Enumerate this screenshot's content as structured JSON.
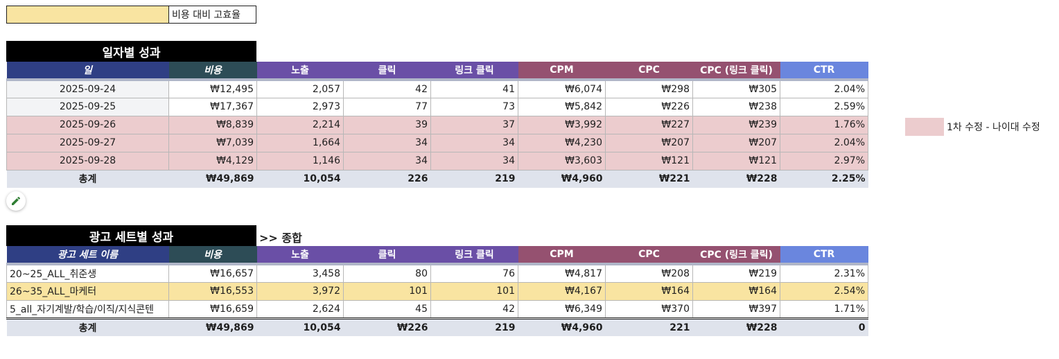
{
  "legend_top": {
    "label": "비용 대비 고효율",
    "color": "#f9e4a1"
  },
  "legend_side": {
    "label": "1차 수정 - 나이대 수정",
    "color": "#ecccce"
  },
  "colors": {
    "day_header": "#2f3f84",
    "cost_header": "#2d4c56",
    "purple_header": "#6a4fa6",
    "wine_header": "#955170",
    "ctr_header": "#6a86de",
    "highlight_pink": "#ecccce",
    "highlight_yellow": "#f9e4a1"
  },
  "daily": {
    "title": "일자별 성과",
    "headers": [
      "일",
      "비용",
      "노출",
      "클릭",
      "링크 클릭",
      "CPM",
      "CPC",
      "CPC (링크 클릭)",
      "CTR"
    ],
    "rows": [
      {
        "cells": [
          "2025-09-24",
          "₩12,495",
          "2,057",
          "42",
          "41",
          "₩6,074",
          "₩298",
          "₩305",
          "2.04%"
        ],
        "highlight": "none"
      },
      {
        "cells": [
          "2025-09-25",
          "₩17,367",
          "2,973",
          "77",
          "73",
          "₩5,842",
          "₩226",
          "₩238",
          "2.59%"
        ],
        "highlight": "none"
      },
      {
        "cells": [
          "2025-09-26",
          "₩8,839",
          "2,214",
          "39",
          "37",
          "₩3,992",
          "₩227",
          "₩239",
          "1.76%"
        ],
        "highlight": "pink"
      },
      {
        "cells": [
          "2025-09-27",
          "₩7,039",
          "1,664",
          "34",
          "34",
          "₩4,230",
          "₩207",
          "₩207",
          "2.04%"
        ],
        "highlight": "pink"
      },
      {
        "cells": [
          "2025-09-28",
          "₩4,129",
          "1,146",
          "34",
          "34",
          "₩3,603",
          "₩121",
          "₩121",
          "2.97%"
        ],
        "highlight": "pink"
      }
    ],
    "total": [
      "총계",
      "₩49,869",
      "10,054",
      "226",
      "219",
      "₩4,960",
      "₩221",
      "₩228",
      "2.25%"
    ]
  },
  "adset": {
    "title": "광고 세트별 성과",
    "aside": ">> 종합",
    "headers": [
      "광고 세트 이름",
      "비용",
      "노출",
      "클릭",
      "링크 클릭",
      "CPM",
      "CPC",
      "CPC (링크 클릭)",
      "CTR"
    ],
    "rows": [
      {
        "cells": [
          "20~25_ALL_취준생",
          "₩16,657",
          "3,458",
          "80",
          "76",
          "₩4,817",
          "₩208",
          "₩219",
          "2.31%"
        ],
        "highlight": "none"
      },
      {
        "cells": [
          "26~35_ALL_마케터",
          "₩16,553",
          "3,972",
          "101",
          "101",
          "₩4,167",
          "₩164",
          "₩164",
          "2.54%"
        ],
        "highlight": "yellow"
      },
      {
        "cells": [
          "5_all_자기계발/학습/이직/지식콘텐",
          "₩16,659",
          "2,624",
          "45",
          "42",
          "₩6,349",
          "₩370",
          "₩397",
          "1.71%"
        ],
        "highlight": "none"
      }
    ],
    "total": [
      "총계",
      "₩49,869",
      "10,054",
      "₩226",
      "219",
      "₩4,960",
      "221",
      "₩228",
      "0"
    ]
  },
  "edit_button": {
    "icon": "pencil-icon"
  }
}
